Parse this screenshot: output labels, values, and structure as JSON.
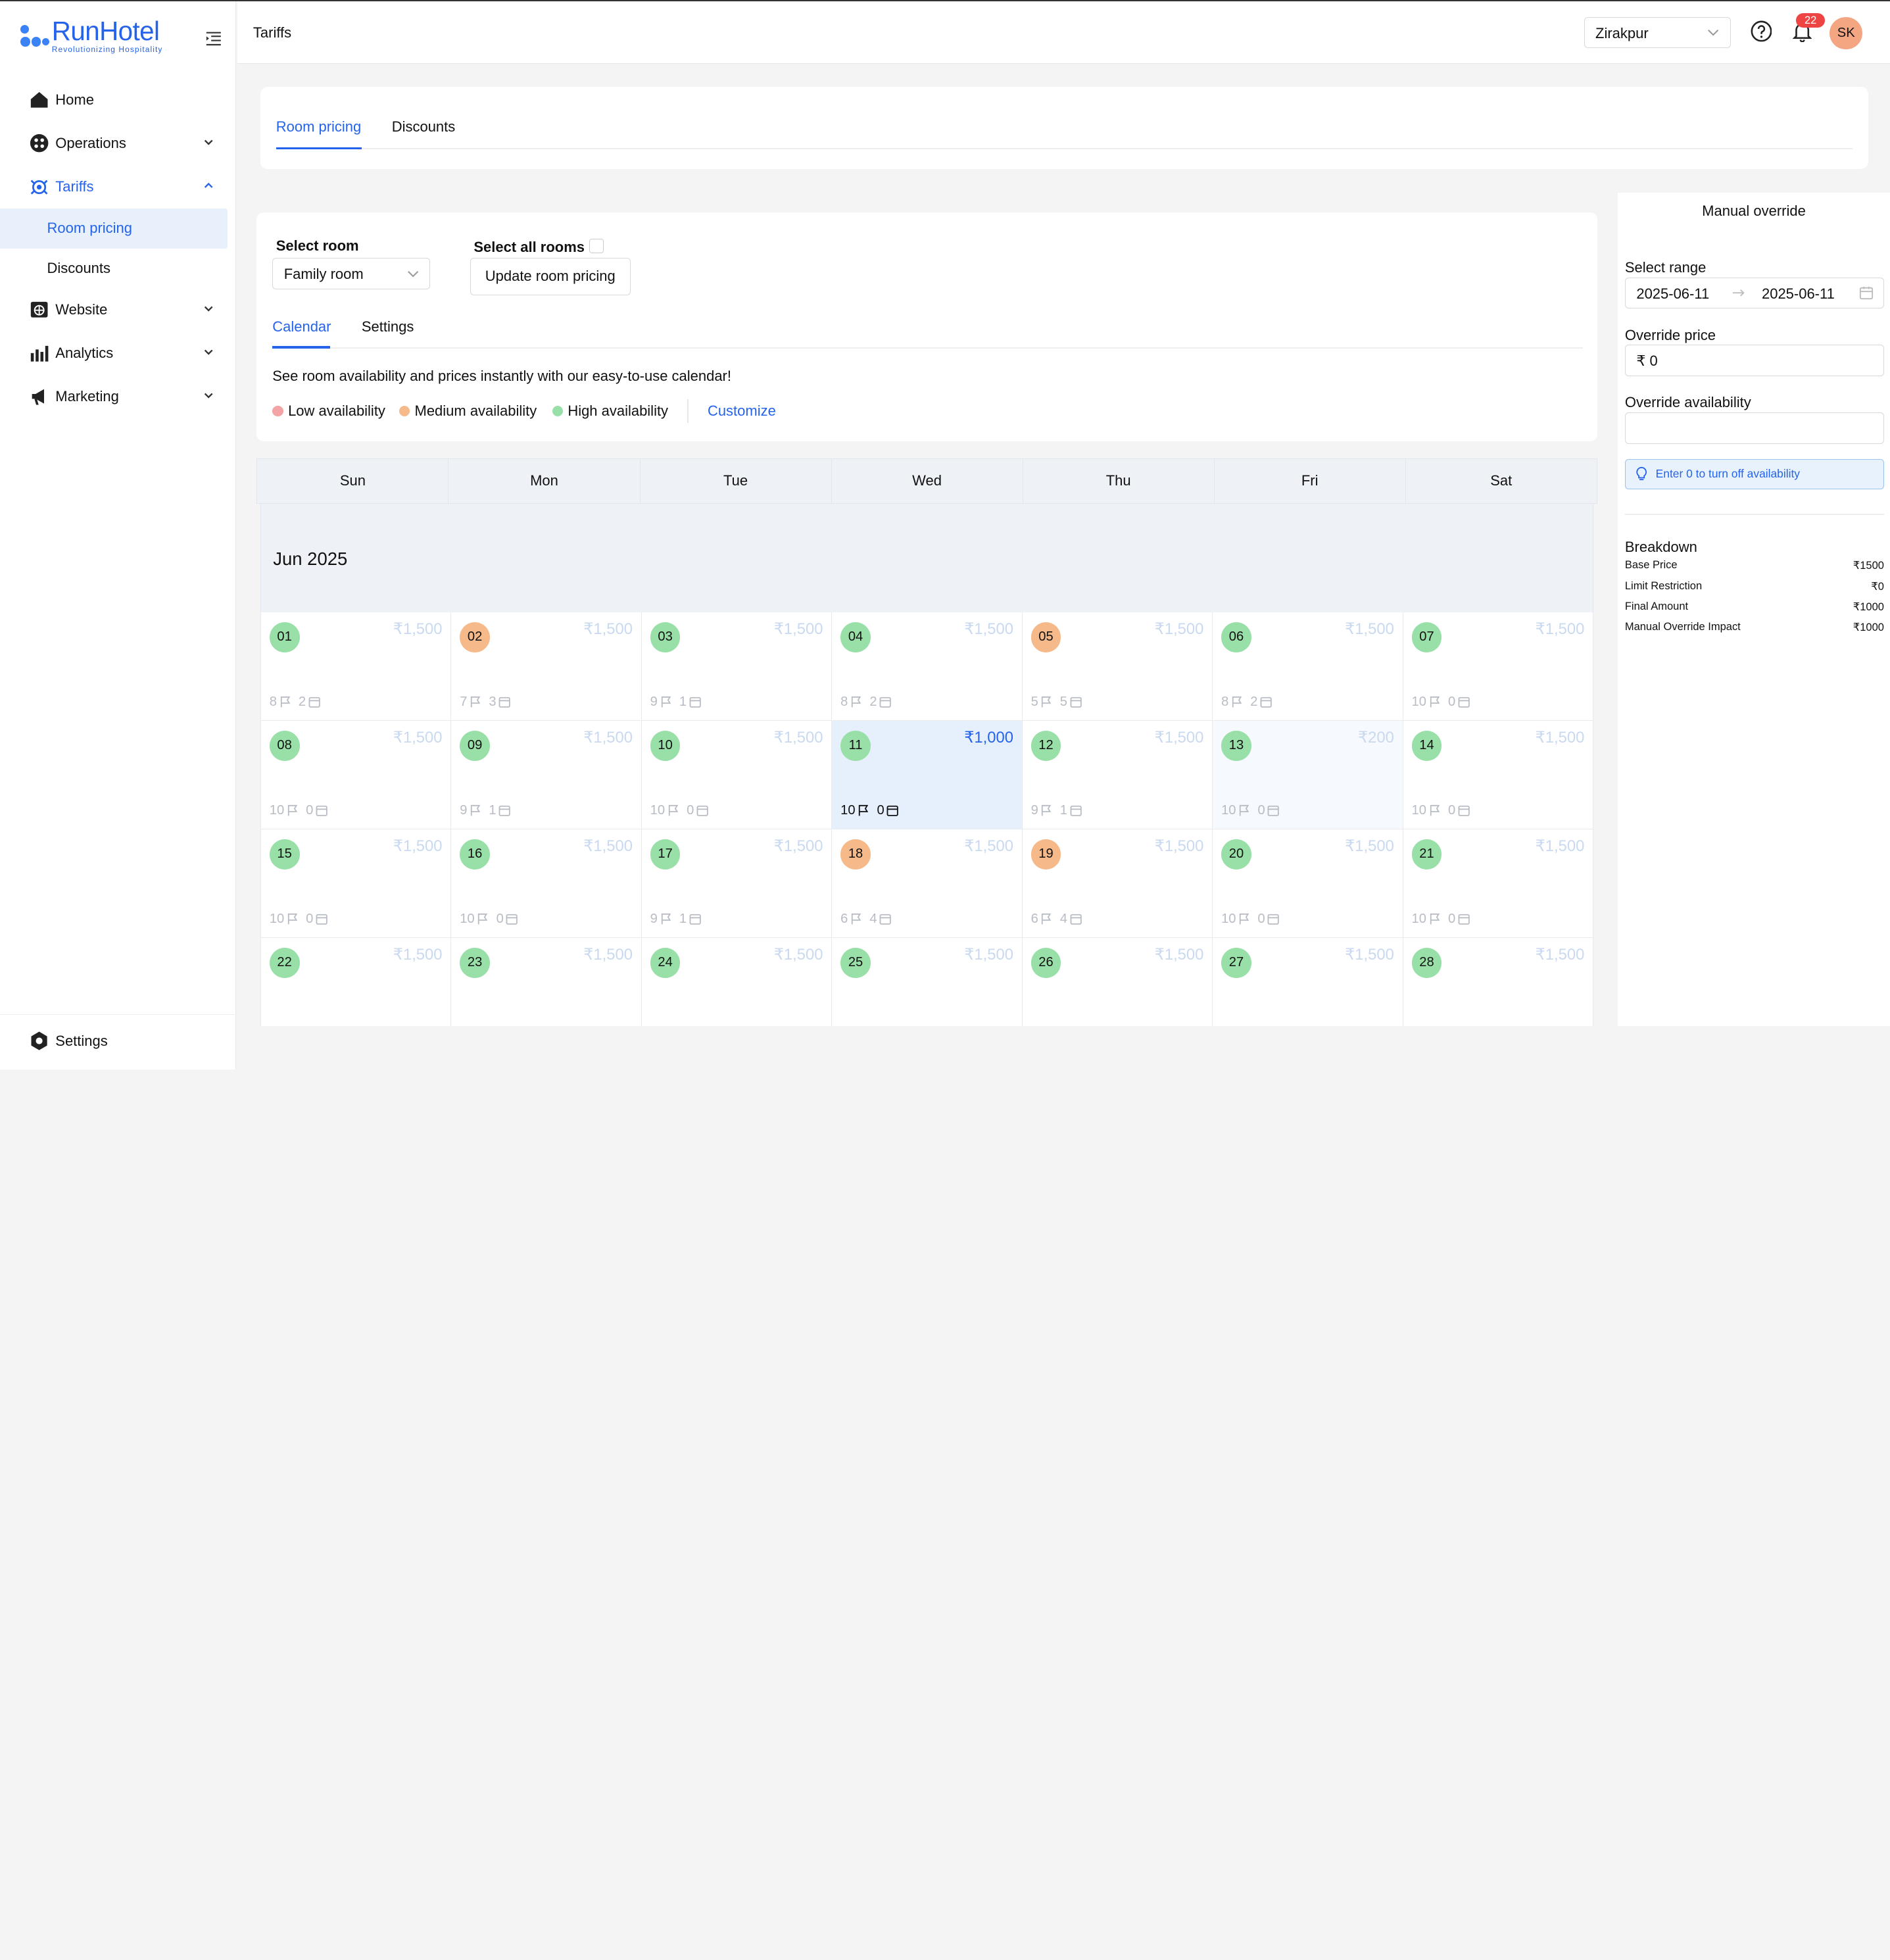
{
  "brand": {
    "name": "RunHotel",
    "tagline": "Revolutionizing Hospitality",
    "color": "#2563eb"
  },
  "sidebar": {
    "items": [
      {
        "label": "Home",
        "icon": "home-icon"
      },
      {
        "label": "Operations",
        "icon": "operations-icon",
        "expanded": false
      },
      {
        "label": "Tariffs",
        "icon": "tariffs-icon",
        "expanded": true,
        "active": true
      },
      {
        "label": "Website",
        "icon": "globe-icon",
        "expanded": false
      },
      {
        "label": "Analytics",
        "icon": "bar-chart-icon",
        "expanded": false
      },
      {
        "label": "Marketing",
        "icon": "megaphone-icon",
        "expanded": false
      }
    ],
    "tariff_subitems": [
      {
        "label": "Room pricing",
        "active": true
      },
      {
        "label": "Discounts",
        "active": false
      }
    ],
    "settings_label": "Settings"
  },
  "header": {
    "breadcrumb": "Tariffs",
    "location": "Zirakpur",
    "notification_count": "22",
    "avatar_initials": "SK"
  },
  "tabs": {
    "room_pricing": "Room pricing",
    "discounts": "Discounts",
    "active": "Room pricing"
  },
  "controls": {
    "select_room_label": "Select room",
    "select_room_value": "Family room",
    "select_all_label": "Select all rooms",
    "select_all_checked": false,
    "update_button": "Update room pricing",
    "subtab_calendar": "Calendar",
    "subtab_settings": "Settings",
    "description": "See room availability and prices instantly with our easy-to-use calendar!",
    "legend": {
      "low": "Low availability",
      "medium": "Medium availability",
      "high": "High availability",
      "low_color": "#f4a4a4",
      "medium_color": "#f5b98a",
      "high_color": "#98e0a8"
    },
    "customize": "Customize"
  },
  "calendar": {
    "weekdays": [
      "Sun",
      "Mon",
      "Tue",
      "Wed",
      "Thu",
      "Fri",
      "Sat"
    ],
    "month": "Jun 2025",
    "weeks": [
      [
        {
          "day": "01",
          "price": "₹1,500",
          "a": "8",
          "b": "2",
          "level": "high"
        },
        {
          "day": "02",
          "price": "₹1,500",
          "a": "7",
          "b": "3",
          "level": "medium"
        },
        {
          "day": "03",
          "price": "₹1,500",
          "a": "9",
          "b": "1",
          "level": "high"
        },
        {
          "day": "04",
          "price": "₹1,500",
          "a": "8",
          "b": "2",
          "level": "high"
        },
        {
          "day": "05",
          "price": "₹1,500",
          "a": "5",
          "b": "5",
          "level": "medium"
        },
        {
          "day": "06",
          "price": "₹1,500",
          "a": "8",
          "b": "2",
          "level": "high"
        },
        {
          "day": "07",
          "price": "₹1,500",
          "a": "10",
          "b": "0",
          "level": "high"
        }
      ],
      [
        {
          "day": "08",
          "price": "₹1,500",
          "a": "10",
          "b": "0",
          "level": "high"
        },
        {
          "day": "09",
          "price": "₹1,500",
          "a": "9",
          "b": "1",
          "level": "high"
        },
        {
          "day": "10",
          "price": "₹1,500",
          "a": "10",
          "b": "0",
          "level": "high"
        },
        {
          "day": "11",
          "price": "₹1,000",
          "a": "10",
          "b": "0",
          "level": "high",
          "selected": true
        },
        {
          "day": "12",
          "price": "₹1,500",
          "a": "9",
          "b": "1",
          "level": "high"
        },
        {
          "day": "13",
          "price": "₹200",
          "a": "10",
          "b": "0",
          "level": "high",
          "light": true
        },
        {
          "day": "14",
          "price": "₹1,500",
          "a": "10",
          "b": "0",
          "level": "high"
        }
      ],
      [
        {
          "day": "15",
          "price": "₹1,500",
          "a": "10",
          "b": "0",
          "level": "high"
        },
        {
          "day": "16",
          "price": "₹1,500",
          "a": "10",
          "b": "0",
          "level": "high"
        },
        {
          "day": "17",
          "price": "₹1,500",
          "a": "9",
          "b": "1",
          "level": "high"
        },
        {
          "day": "18",
          "price": "₹1,500",
          "a": "6",
          "b": "4",
          "level": "medium"
        },
        {
          "day": "19",
          "price": "₹1,500",
          "a": "6",
          "b": "4",
          "level": "medium"
        },
        {
          "day": "20",
          "price": "₹1,500",
          "a": "10",
          "b": "0",
          "level": "high"
        },
        {
          "day": "21",
          "price": "₹1,500",
          "a": "10",
          "b": "0",
          "level": "high"
        }
      ],
      [
        {
          "day": "22",
          "price": "₹1,500",
          "a": "",
          "b": "",
          "level": "high"
        },
        {
          "day": "23",
          "price": "₹1,500",
          "a": "",
          "b": "",
          "level": "high"
        },
        {
          "day": "24",
          "price": "₹1,500",
          "a": "",
          "b": "",
          "level": "high"
        },
        {
          "day": "25",
          "price": "₹1,500",
          "a": "",
          "b": "",
          "level": "high"
        },
        {
          "day": "26",
          "price": "₹1,500",
          "a": "",
          "b": "",
          "level": "high"
        },
        {
          "day": "27",
          "price": "₹1,500",
          "a": "",
          "b": "",
          "level": "high"
        },
        {
          "day": "28",
          "price": "₹1,500",
          "a": "",
          "b": "",
          "level": "high"
        }
      ]
    ]
  },
  "override": {
    "title": "Manual override",
    "range_label": "Select range",
    "range_start": "2025-06-11",
    "range_end": "2025-06-11",
    "price_label": "Override price",
    "price_value": "₹ 0",
    "availability_label": "Override availability",
    "availability_value": "",
    "hint": "Enter 0 to turn off availability",
    "breakdown_title": "Breakdown",
    "breakdown": [
      {
        "label": "Base Price",
        "value": "₹1500"
      },
      {
        "label": "Limit Restriction",
        "value": "₹0"
      },
      {
        "label": "Final Amount",
        "value": "₹1000"
      },
      {
        "label": "Manual Override Impact",
        "value": "₹1000"
      }
    ]
  }
}
